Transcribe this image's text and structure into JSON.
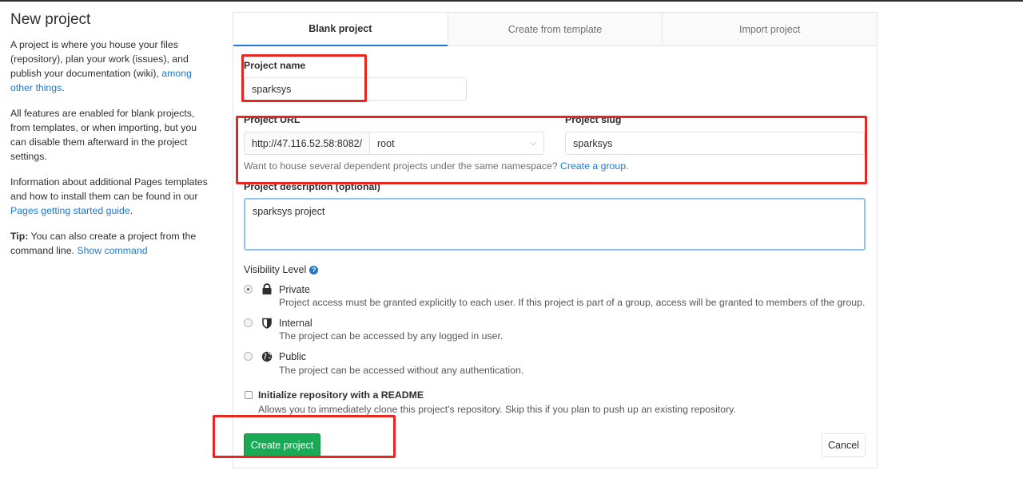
{
  "sidebar": {
    "title": "New project",
    "p1_text": "A project is where you house your files (repository), plan your work (issues), and publish your documentation (wiki),",
    "p1_link": "among other things",
    "p1_end": ".",
    "p2_text": "All features are enabled for blank projects, from templates, or when importing, but you can disable them afterward in the project settings.",
    "p3_text": "Information about additional Pages templates and how to install them can be found in our",
    "p3_link": "Pages getting started guide",
    "p3_end": ".",
    "tip_label": "Tip:",
    "tip_text": "You can also create a project from the command line.",
    "tip_link": "Show command"
  },
  "tabs": [
    {
      "label": "Blank project",
      "active": true
    },
    {
      "label": "Create from template",
      "active": false
    },
    {
      "label": "Import project",
      "active": false
    }
  ],
  "form": {
    "project_name_label": "Project name",
    "project_name_value": "sparksys",
    "project_url_label": "Project URL",
    "url_prefix": "http://47.116.52.58:8082/",
    "namespace_value": "root",
    "project_slug_label": "Project slug",
    "project_slug_value": "sparksys",
    "namespace_help": "Want to house several dependent projects under the same namespace?",
    "namespace_help_link": "Create a group.",
    "description_label": "Project description (optional)",
    "description_value": "sparksys project",
    "visibility_label": "Visibility Level",
    "visibility_options": [
      {
        "title": "Private",
        "desc": "Project access must be granted explicitly to each user. If this project is part of a group, access will be granted to members of the group.",
        "icon": "lock-icon",
        "checked": true
      },
      {
        "title": "Internal",
        "desc": "The project can be accessed by any logged in user.",
        "icon": "shield-icon",
        "checked": false
      },
      {
        "title": "Public",
        "desc": "The project can be accessed without any authentication.",
        "icon": "globe-icon",
        "checked": false
      }
    ],
    "readme_label": "Initialize repository with a README",
    "readme_desc": "Allows you to immediately clone this project's repository. Skip this if you plan to push up an existing repository.",
    "readme_checked": false,
    "create_button": "Create project",
    "cancel_button": "Cancel"
  },
  "colors": {
    "accent": "#1f78d1",
    "success": "#1aaa55",
    "highlight": "#e8261f"
  }
}
